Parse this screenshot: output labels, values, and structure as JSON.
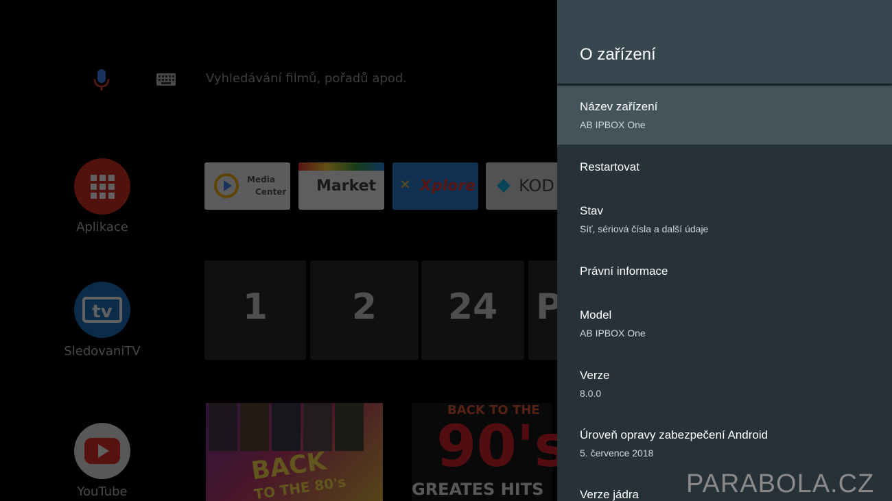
{
  "home": {
    "search_placeholder": "Vyhledávání filmů, pořadů apod.",
    "rows": [
      {
        "label": "Aplikace"
      },
      {
        "label": "SledovaniTV"
      },
      {
        "label": "YouTube"
      }
    ],
    "app_tiles": [
      {
        "label_line1": "Media",
        "label_line2": "Center"
      },
      {
        "label": "Market"
      },
      {
        "label": "Xplore"
      },
      {
        "label": "KOD"
      }
    ],
    "channels": [
      "1",
      "2",
      "24",
      "P"
    ],
    "videos": [
      {
        "title_line1": "BACK",
        "title_line2": "TO THE 80's"
      },
      {
        "top": "BACK TO THE",
        "mid": "90's",
        "bottom": "GREATES HITS"
      }
    ]
  },
  "settings": {
    "title": "O zařízení",
    "items": [
      {
        "title": "Název zařízení",
        "subtitle": "AB IPBOX One",
        "focused": true
      },
      {
        "title": "Restartovat"
      },
      {
        "title": "Stav",
        "subtitle": "Síť, sériová čísla a další údaje"
      },
      {
        "title": "Právní informace"
      },
      {
        "title": "Model",
        "subtitle": "AB IPBOX One"
      },
      {
        "title": "Verze",
        "subtitle": "8.0.0"
      },
      {
        "title": "Úroveň opravy zabezpečení Android",
        "subtitle": "5. července 2018"
      },
      {
        "title": "Verze jádra"
      }
    ]
  },
  "watermark": "PARABOLA.CZ",
  "colors": {
    "panel_bg": "#263238",
    "panel_header": "#37474f",
    "focused_item": "#44545b",
    "mic": "#4285f4",
    "apps_red": "#d62d20",
    "tv_blue": "#1e73be"
  }
}
